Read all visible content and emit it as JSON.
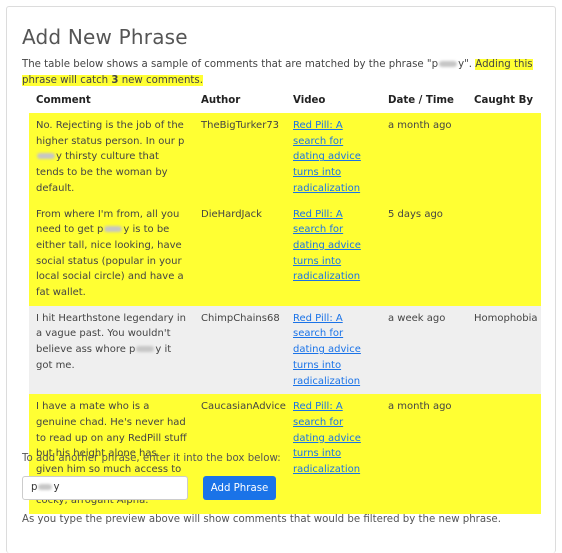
{
  "title": "Add New Phrase",
  "intro": {
    "text_before": "The table below shows a sample of comments that are matched by the phrase \"p",
    "text_after_phrase": "y\". ",
    "highlight_1": "Adding this phrase will catch ",
    "count": "3",
    "highlight_2": " new comments."
  },
  "table": {
    "headers": [
      "Comment",
      "Author",
      "Video",
      "Date / Time",
      "Caught By"
    ],
    "rows": [
      {
        "comment_before": "No. Rejecting is the job of the higher status person. In our p",
        "comment_after": "y thirsty culture that tends to be the woman by default.",
        "author": "TheBigTurker73",
        "video": "Red Pill: A search for dating advice turns into radicalization",
        "date": "a month ago",
        "caught_by": "",
        "highlight": true
      },
      {
        "comment_before": "From where I'm from, all you need to get p",
        "comment_after": "y is to be either tall, nice looking, have social status (popular in your local social circle) and have a fat wallet.",
        "author": "DieHardJack",
        "video": "Red Pill: A search for dating advice turns into radicalization",
        "date": "5 days ago",
        "caught_by": "",
        "highlight": true
      },
      {
        "comment_before": "I hit Hearthstone legendary in a vague past. You wouldn't believe ass whore p",
        "comment_after": "y it got me.",
        "author": "ChimpChains68",
        "video": "Red Pill: A search for dating advice turns into radicalization",
        "date": "a week ago",
        "caught_by": "Homophobia",
        "highlight": false
      },
      {
        "comment_before": "I have a mate who is a genuine chad. He's never had to read up on any RedPill stuff but his height alone has given him so much access to p",
        "comment_after": "y that he is a natural, cocky, arrogant Alpha.",
        "author": "CaucasianAdvice",
        "video": "Red Pill: A search for dating advice turns into radicalization",
        "date": "a month ago",
        "caught_by": "",
        "highlight": true
      }
    ]
  },
  "add_another_text": "To add another phrase, enter it into the box below:",
  "input": {
    "value_before": "p",
    "value_after": "y"
  },
  "add_button_label": "Add Phrase",
  "preview_text": "As you type the preview above will show comments that would be filtered by the new phrase.",
  "colors": {
    "highlight": "#ffff33",
    "row_gray": "#efefef",
    "link": "#1a73e8",
    "button": "#1a73e8"
  }
}
